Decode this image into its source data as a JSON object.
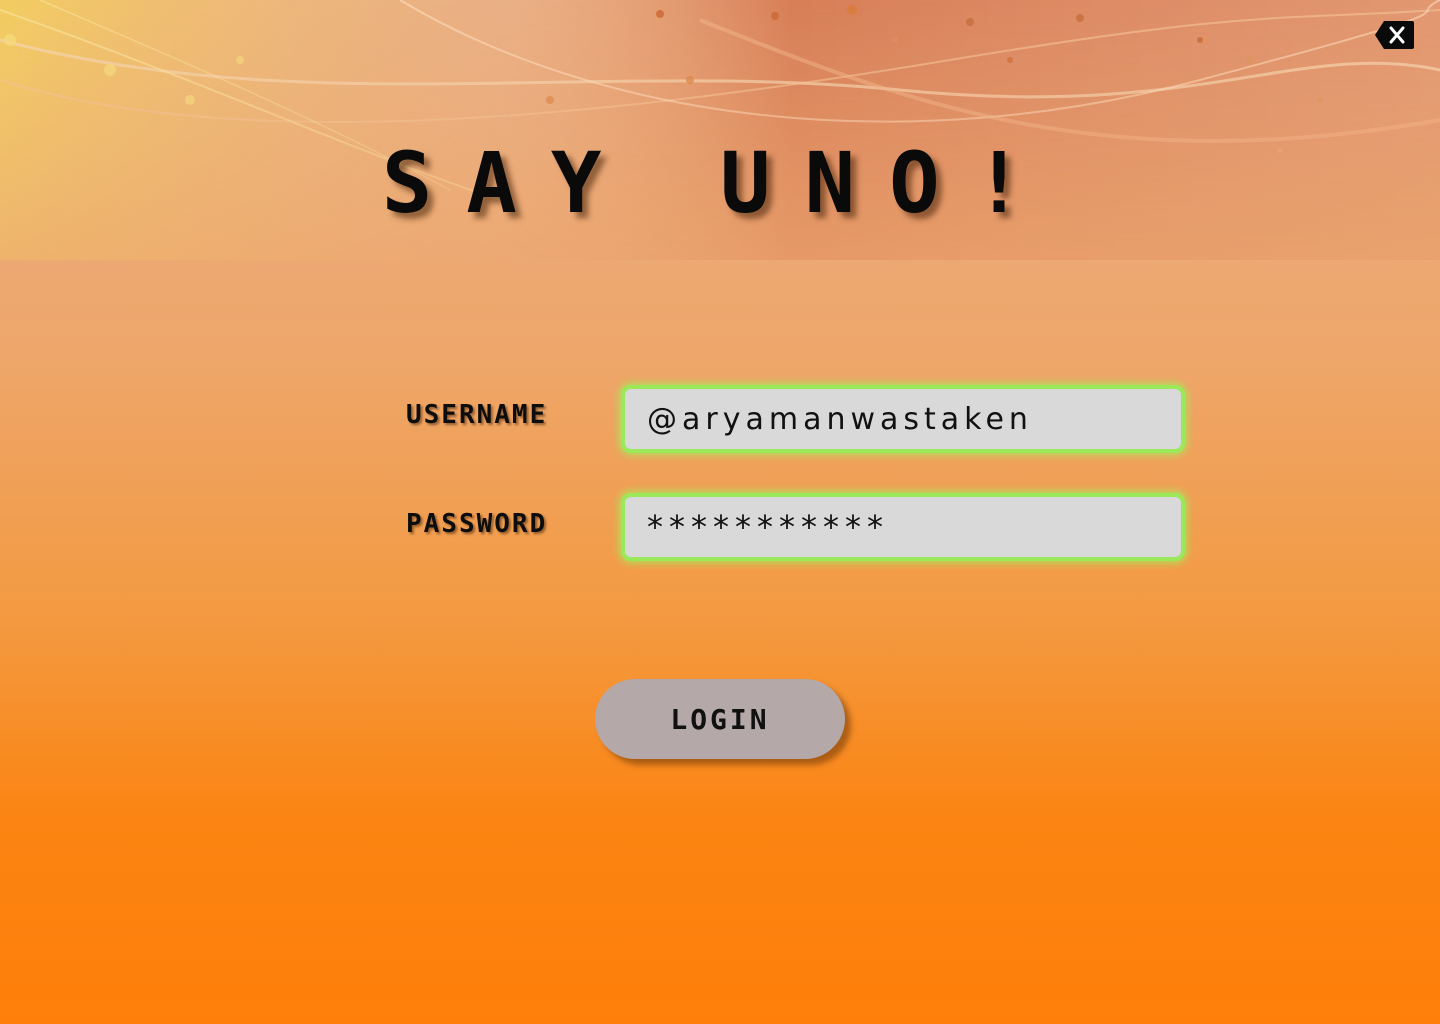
{
  "app": {
    "title": "SAY UNO!"
  },
  "close_button": {
    "icon": "backspace-close-icon"
  },
  "form": {
    "username_label": "USERNAME",
    "username_value": "@aryamanwastaken",
    "password_label": "PASSWORD",
    "password_value": "***********",
    "login_label": "LOGIN"
  },
  "colors": {
    "background_top": "#e9b088",
    "background_bottom": "#ff7f0a",
    "field_border": "#9be85a",
    "field_fill": "#d9d9d9",
    "button_fill": "#b4a8a8",
    "text": "#0a0a0a"
  }
}
